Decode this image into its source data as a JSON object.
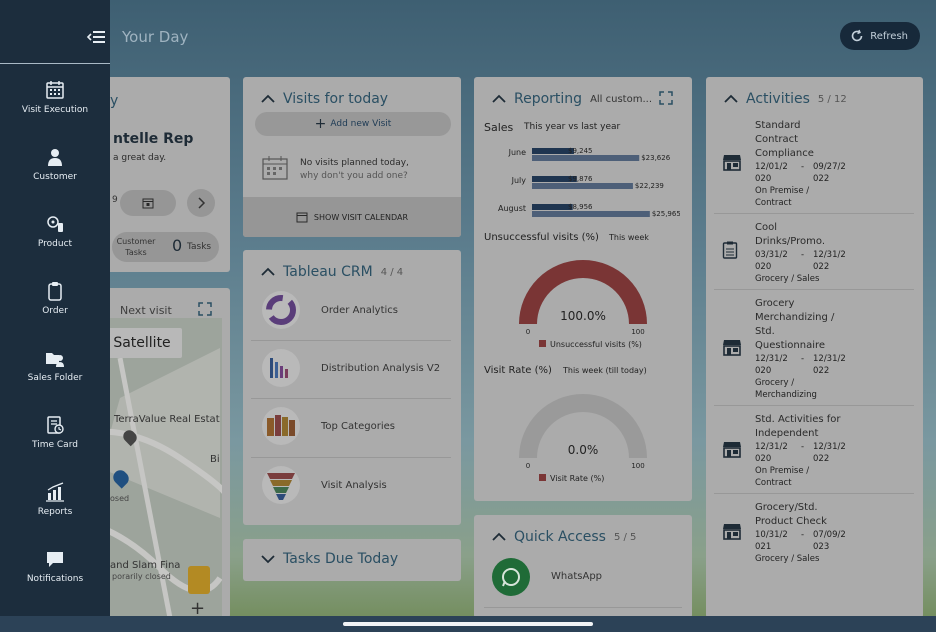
{
  "header": {
    "title": "Your Day",
    "refresh_label": "Refresh"
  },
  "sidebar": {
    "items": [
      {
        "label": "Visit Execution",
        "icon": "calendar-grid-icon"
      },
      {
        "label": "Customer",
        "icon": "person-icon"
      },
      {
        "label": "Product",
        "icon": "product-icon"
      },
      {
        "label": "Order",
        "icon": "clipboard-icon"
      },
      {
        "label": "Sales Folder",
        "icon": "sales-folder-icon"
      },
      {
        "label": "Time Card",
        "icon": "time-card-icon"
      },
      {
        "label": "Reports",
        "icon": "bar-chart-icon"
      },
      {
        "label": "Notifications",
        "icon": "chat-icon"
      }
    ]
  },
  "profile_card": {
    "title_fragment": "y",
    "name": "ntelle Rep",
    "greeting": "a great day.",
    "day_fragment": "9",
    "customer_tasks_label": "Customer Tasks",
    "tasks_count": "0",
    "tasks_label": "Tasks"
  },
  "map_card": {
    "next_visit": "Next visit",
    "map_type": "Satellite",
    "labels": [
      "TerraValue Real Estat",
      "Bi",
      "osed",
      "and Slam Fina",
      "porarily closed",
      "Sendo"
    ]
  },
  "visits": {
    "title": "Visits for today",
    "add_label": "Add new Visit",
    "empty_title": "No visits planned today,",
    "empty_sub": "why don't you add one?",
    "calendar_button": "SHOW VISIT CALENDAR"
  },
  "tableau": {
    "title": "Tableau CRM",
    "count": "4 / 4",
    "items": [
      {
        "label": "Order Analytics"
      },
      {
        "label": "Distribution Analysis V2"
      },
      {
        "label": "Top Categories"
      },
      {
        "label": "Visit Analysis"
      }
    ]
  },
  "tasks_due": {
    "title": "Tasks Due Today"
  },
  "reporting": {
    "title": "Reporting",
    "subtitle": "All custom...",
    "sales_label": "Sales",
    "sales_period": "This year vs last year",
    "unsuccessful_label": "Unsuccessful visits (%)",
    "unsuccessful_period": "This week",
    "visit_rate_label": "Visit Rate (%)",
    "visit_rate_period": "This week (till today)"
  },
  "chart_data": [
    {
      "type": "bar",
      "title": "Sales",
      "subtitle": "This year vs last year",
      "categories": [
        "June",
        "July",
        "August"
      ],
      "series": [
        {
          "values": [
            9245,
            9876,
            8956
          ]
        },
        {
          "values": [
            23626,
            22239,
            25965
          ]
        }
      ],
      "value_labels": [
        [
          "$9,245",
          "$23,626"
        ],
        [
          "$9,876",
          "$22,239"
        ],
        [
          "$8,956",
          "$25,965"
        ]
      ],
      "colors": [
        "#1f3550",
        "#4d5f78"
      ]
    },
    {
      "type": "pie",
      "title": "Unsuccessful visits (%)",
      "subtitle": "This week",
      "value": 100.0,
      "value_label": "100.0%",
      "min": 0,
      "max": 100,
      "legend": "Unsuccessful visits (%)",
      "color": "#7a3535"
    },
    {
      "type": "pie",
      "title": "Visit Rate (%)",
      "subtitle": "This week (till today)",
      "value": 0.0,
      "value_label": "0.0%",
      "min": 0,
      "max": 100,
      "legend": "Visit Rate (%)",
      "color": "#7a3535"
    }
  ],
  "quick_access": {
    "title": "Quick Access",
    "count": "5 / 5",
    "items": [
      {
        "label": "WhatsApp"
      }
    ]
  },
  "activities": {
    "title": "Activities",
    "count": "5 / 12",
    "items": [
      {
        "title_lines": [
          "Standard",
          "Contract",
          "Compliance"
        ],
        "date_from": "12/01/2",
        "date_to": "09/27/2",
        "year_from": "020",
        "year_to": "022",
        "category_lines": [
          "On Premise /",
          "Contract"
        ],
        "icon": "store-icon"
      },
      {
        "title_lines": [
          "Cool",
          "Drinks/Promo."
        ],
        "date_from": "03/31/2",
        "date_to": "12/31/2",
        "year_from": "020",
        "year_to": "022",
        "category_lines": [
          "Grocery / Sales"
        ],
        "icon": "checklist-icon"
      },
      {
        "title_lines": [
          "Grocery",
          "Merchandizing /",
          "Std.",
          "Questionnaire"
        ],
        "date_from": "12/31/2",
        "date_to": "12/31/2",
        "year_from": "020",
        "year_to": "022",
        "category_lines": [
          "Grocery /",
          "Merchandizing"
        ],
        "icon": "store-icon"
      },
      {
        "title_lines": [
          "Std. Activities for",
          "Independent"
        ],
        "date_from": "12/31/2",
        "date_to": "12/31/2",
        "year_from": "020",
        "year_to": "022",
        "category_lines": [
          "On Premise /",
          "Contract"
        ],
        "icon": "store-icon"
      },
      {
        "title_lines": [
          "Grocery/Std.",
          "Product Check"
        ],
        "date_from": "10/31/2",
        "date_to": "07/09/2",
        "year_from": "021",
        "year_to": "023",
        "category_lines": [
          "Grocery / Sales"
        ],
        "icon": "store-icon"
      }
    ]
  }
}
